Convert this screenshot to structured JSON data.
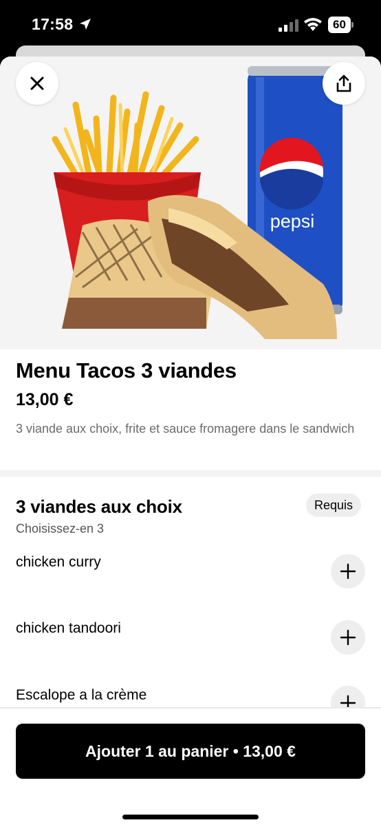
{
  "status_bar": {
    "time": "17:58",
    "battery_level": "60"
  },
  "product": {
    "title": "Menu Tacos 3 viandes",
    "price": "13,00 €",
    "description": "3 viande aux choix, frite et sauce fromagere  dans le sandwich",
    "image_brand_text": "pepsi"
  },
  "options_section": {
    "title": "3 viandes aux choix",
    "required_label": "Requis",
    "subtitle": "Choisissez-en 3",
    "options": [
      {
        "label": "chicken curry"
      },
      {
        "label": "chicken tandoori"
      },
      {
        "label": "Escalope a la crème"
      }
    ]
  },
  "footer": {
    "cta_label": "Ajouter 1 au panier • 13,00 €"
  },
  "icons": [
    "location-arrow-icon",
    "signal-icon",
    "wifi-icon",
    "battery-icon",
    "close-icon",
    "share-icon",
    "plus-icon"
  ],
  "colors": {
    "cta_background": "#000000",
    "badge_background": "#eeeeee",
    "pepsi_blue": "#1e4fc4"
  }
}
